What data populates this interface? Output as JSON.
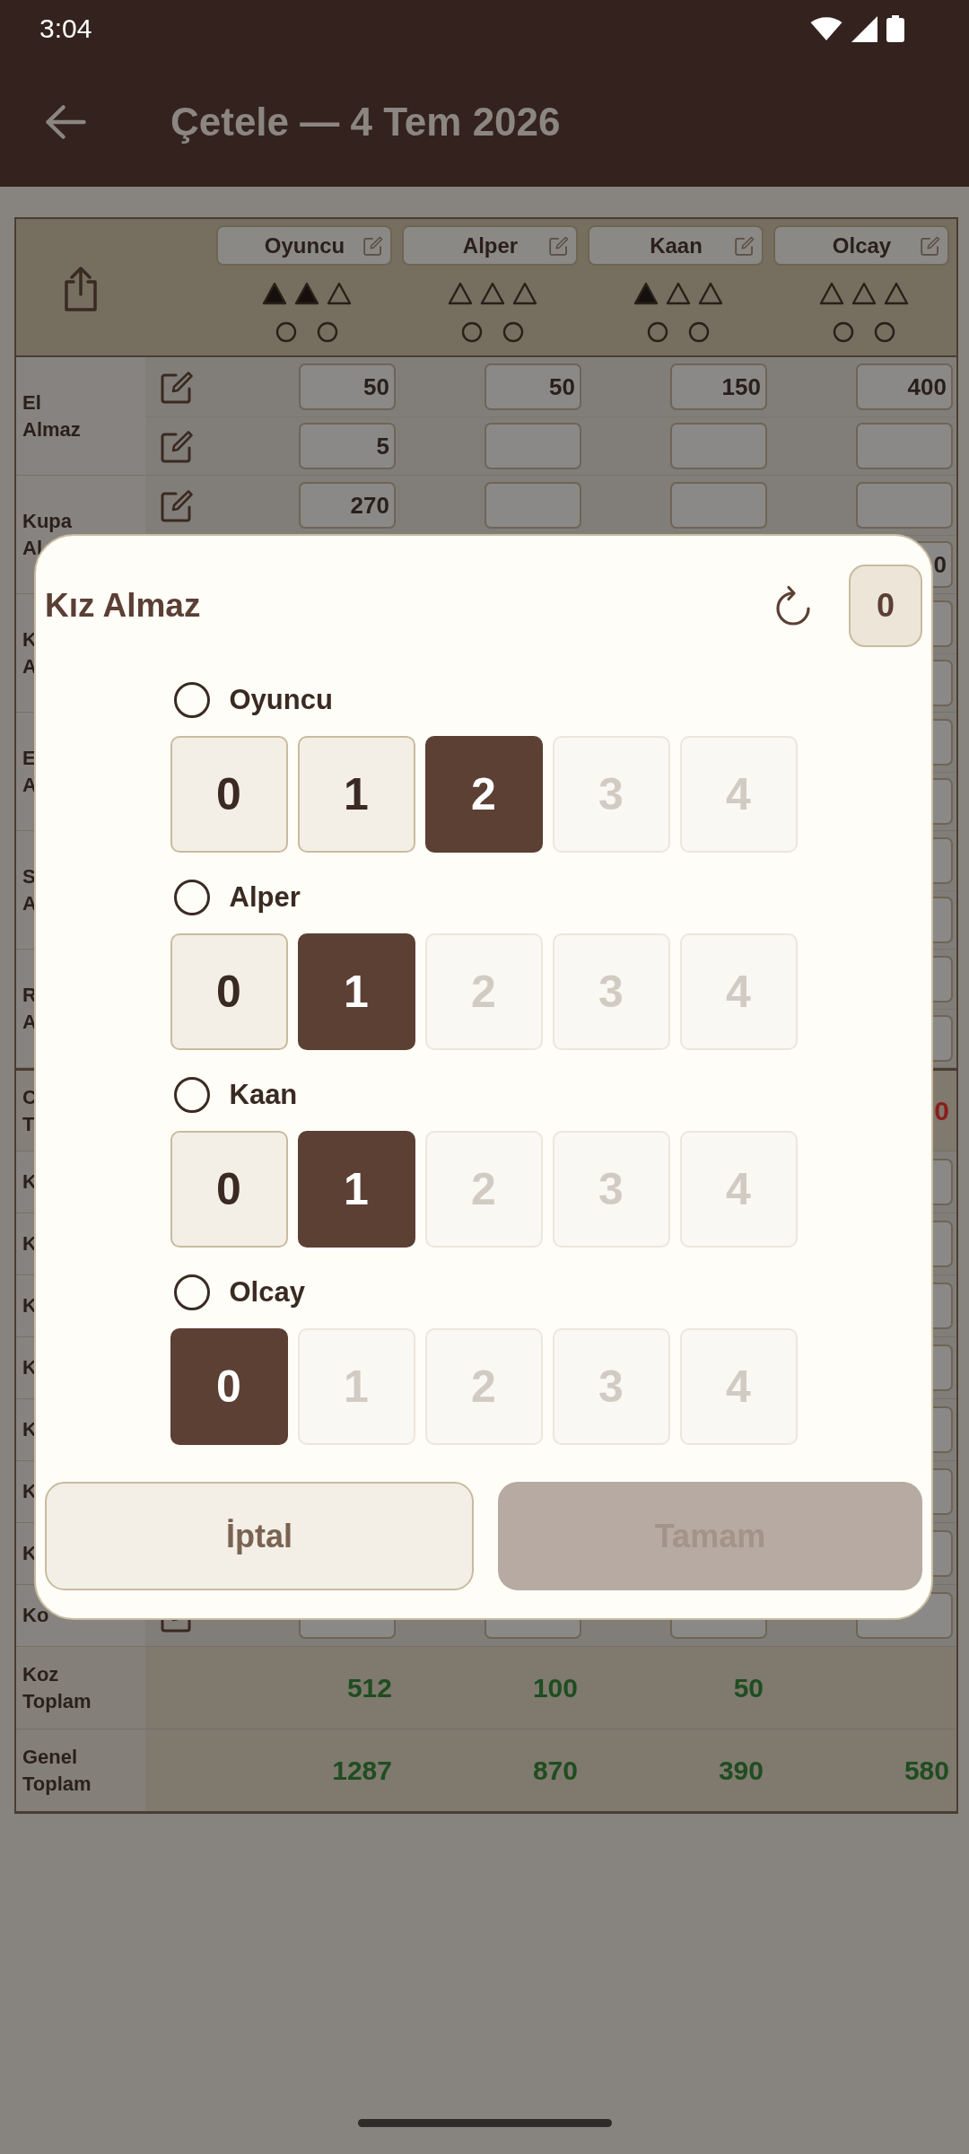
{
  "status_bar": {
    "time": "3:04"
  },
  "app_bar": {
    "title": "Çetele — 4 Tem 2026"
  },
  "table": {
    "players": [
      {
        "name": "Oyuncu",
        "triangles": [
          {
            "filled": true
          },
          {
            "filled": true
          },
          {
            "filled": false
          }
        ],
        "circles": [
          {
            "filled": false
          },
          {
            "filled": false
          }
        ]
      },
      {
        "name": "Alper",
        "triangles": [
          {
            "filled": false
          },
          {
            "filled": false
          },
          {
            "filled": false
          }
        ],
        "circles": [
          {
            "filled": false
          },
          {
            "filled": false
          }
        ]
      },
      {
        "name": "Kaan",
        "triangles": [
          {
            "filled": true
          },
          {
            "filled": false
          },
          {
            "filled": false
          }
        ],
        "circles": [
          {
            "filled": false
          },
          {
            "filled": false
          }
        ]
      },
      {
        "name": "Olcay",
        "triangles": [
          {
            "filled": false
          },
          {
            "filled": false
          },
          {
            "filled": false
          }
        ],
        "circles": [
          {
            "filled": false
          },
          {
            "filled": false
          }
        ]
      }
    ],
    "rows": [
      {
        "kind": "entry",
        "label": "El\nAlmaz",
        "lines": [
          {
            "edit_icon": true,
            "cells": [
              {
                "kind": "filled",
                "value": "50"
              },
              {
                "kind": "filled",
                "value": "50"
              },
              {
                "kind": "filled",
                "value": "150"
              },
              {
                "kind": "filled",
                "value": "400"
              }
            ]
          },
          {
            "edit_icon": true,
            "cells": [
              {
                "kind": "filled",
                "value": "5"
              },
              {
                "kind": "blank"
              },
              {
                "kind": "blank"
              },
              {
                "kind": "blank"
              }
            ]
          }
        ]
      },
      {
        "kind": "entry",
        "label": "Kupa\nAl",
        "lines": [
          {
            "edit_icon": true,
            "cells": [
              {
                "kind": "filled",
                "value": "270"
              },
              {
                "kind": "blank"
              },
              {
                "kind": "blank"
              },
              {
                "kind": "blank"
              }
            ]
          },
          {
            "cells": [
              {
                "kind": "filled",
                "value": "0"
              }
            ]
          }
        ]
      },
      {
        "kind": "entry",
        "label": "K\nA",
        "lines": [
          {
            "cells": [
              {
                "kind": "blank"
              }
            ]
          },
          {
            "cells": [
              {
                "kind": "blank"
              }
            ]
          }
        ]
      },
      {
        "kind": "entry",
        "label": "E\nA",
        "lines": [
          {
            "cells": [
              {
                "kind": "blank"
              }
            ]
          },
          {
            "cells": [
              {
                "kind": "blank"
              }
            ]
          }
        ]
      },
      {
        "kind": "entry",
        "label": "S\nA",
        "lines": [
          {
            "cells": [
              {
                "kind": "blank"
              }
            ]
          },
          {
            "cells": [
              {
                "kind": "blank"
              }
            ]
          }
        ]
      },
      {
        "kind": "entry",
        "label": "R\nA",
        "lines": [
          {
            "cells": [
              {
                "kind": "blank"
              }
            ]
          },
          {
            "cells": [
              {
                "kind": "blank"
              }
            ]
          }
        ]
      },
      {
        "kind": "total",
        "label": "C\nT",
        "color": "#8c1c1c",
        "values": [
          {
            "kind": "number",
            "text": "0"
          }
        ]
      },
      {
        "kind": "entry",
        "label": "K",
        "lines": [
          {
            "cells": [
              {
                "kind": "blank"
              }
            ]
          }
        ]
      },
      {
        "kind": "entry",
        "label": "K",
        "lines": [
          {
            "cells": [
              {
                "kind": "blank"
              }
            ]
          }
        ]
      },
      {
        "kind": "entry",
        "label": "K",
        "lines": [
          {
            "cells": [
              {
                "kind": "blank"
              }
            ]
          }
        ]
      },
      {
        "kind": "entry",
        "label": "K",
        "lines": [
          {
            "cells": [
              {
                "kind": "blank"
              }
            ]
          }
        ]
      },
      {
        "kind": "entry",
        "label": "K",
        "lines": [
          {
            "cells": [
              {
                "kind": "blank"
              }
            ]
          }
        ]
      },
      {
        "kind": "entry",
        "label": "K",
        "lines": [
          {
            "cells": [
              {
                "kind": "blank"
              }
            ]
          }
        ]
      },
      {
        "kind": "entry",
        "label": "K",
        "lines": [
          {
            "cells": [
              {
                "kind": "blank"
              }
            ]
          }
        ]
      },
      {
        "kind": "entry",
        "label": "Ko",
        "lines": [
          {
            "edit_icon": true,
            "cells": [
              {
                "kind": "blank"
              },
              {
                "kind": "blank"
              },
              {
                "kind": "blank"
              },
              {
                "kind": "blank"
              }
            ]
          }
        ]
      },
      {
        "kind": "total",
        "label": "Koz\nToplam",
        "color": "#1f4d20",
        "values": [
          {
            "kind": "number",
            "text": "512"
          },
          {
            "kind": "number",
            "text": "100"
          },
          {
            "kind": "number",
            "text": "50"
          },
          {
            "kind": "empty"
          }
        ]
      },
      {
        "kind": "total",
        "label": "Genel\nToplam",
        "color": "#1f4d20",
        "values": [
          {
            "kind": "number",
            "text": "1287"
          },
          {
            "kind": "number",
            "text": "870"
          },
          {
            "kind": "number",
            "text": "390"
          },
          {
            "kind": "number",
            "text": "580"
          }
        ]
      }
    ]
  },
  "dialog": {
    "title": "Kız Almaz",
    "counter": "0",
    "players": [
      {
        "name": "Oyuncu",
        "selected": false,
        "options": [
          {
            "label": "0",
            "selected": false,
            "disabled": false
          },
          {
            "label": "1",
            "selected": false,
            "disabled": false
          },
          {
            "label": "2",
            "selected": true,
            "disabled": false
          },
          {
            "label": "3",
            "selected": false,
            "disabled": true
          },
          {
            "label": "4",
            "selected": false,
            "disabled": true
          }
        ]
      },
      {
        "name": "Alper",
        "selected": false,
        "options": [
          {
            "label": "0",
            "selected": false,
            "disabled": false
          },
          {
            "label": "1",
            "selected": true,
            "disabled": false
          },
          {
            "label": "2",
            "selected": false,
            "disabled": true
          },
          {
            "label": "3",
            "selected": false,
            "disabled": true
          },
          {
            "label": "4",
            "selected": false,
            "disabled": true
          }
        ]
      },
      {
        "name": "Kaan",
        "selected": false,
        "options": [
          {
            "label": "0",
            "selected": false,
            "disabled": false
          },
          {
            "label": "1",
            "selected": true,
            "disabled": false
          },
          {
            "label": "2",
            "selected": false,
            "disabled": true
          },
          {
            "label": "3",
            "selected": false,
            "disabled": true
          },
          {
            "label": "4",
            "selected": false,
            "disabled": true
          }
        ]
      },
      {
        "name": "Olcay",
        "selected": false,
        "options": [
          {
            "label": "0",
            "selected": true,
            "disabled": false
          },
          {
            "label": "1",
            "selected": false,
            "disabled": true
          },
          {
            "label": "2",
            "selected": false,
            "disabled": true
          },
          {
            "label": "3",
            "selected": false,
            "disabled": true
          },
          {
            "label": "4",
            "selected": false,
            "disabled": true
          }
        ]
      }
    ],
    "buttons": [
      {
        "kind": "cancel",
        "label": "İptal",
        "disabled": false
      },
      {
        "kind": "confirm",
        "label": "Tamam",
        "disabled": true
      }
    ]
  }
}
